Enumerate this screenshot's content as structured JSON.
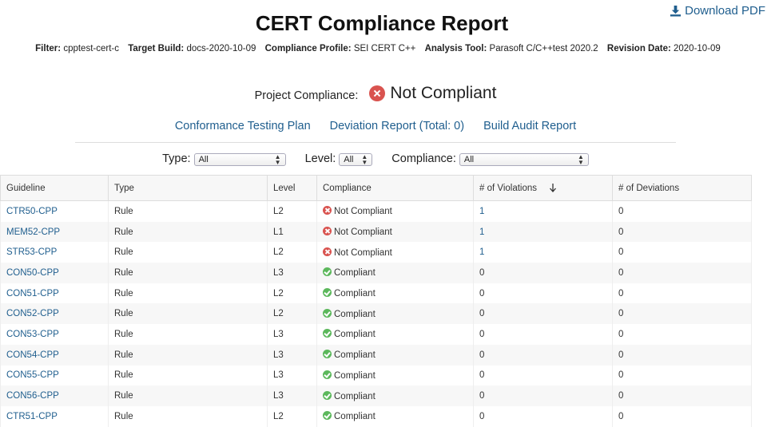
{
  "download_label": "Download PDF",
  "title": "CERT Compliance Report",
  "meta": [
    {
      "label": "Filter:",
      "value": "cpptest-cert-c"
    },
    {
      "label": "Target Build:",
      "value": "docs-2020-10-09"
    },
    {
      "label": "Compliance Profile:",
      "value": "SEI CERT C++"
    },
    {
      "label": "Analysis Tool:",
      "value": "Parasoft C/C++test 2020.2"
    },
    {
      "label": "Revision Date:",
      "value": "2020-10-09"
    }
  ],
  "project": {
    "label": "Project Compliance:",
    "status": "Not Compliant",
    "status_color": "#d9534f"
  },
  "links": {
    "plan": "Conformance Testing Plan",
    "deviation": "Deviation Report (Total: 0)",
    "audit": "Build Audit Report"
  },
  "filters": {
    "type": {
      "label": "Type:",
      "value": "All"
    },
    "level": {
      "label": "Level:",
      "value": "All"
    },
    "compliance": {
      "label": "Compliance:",
      "value": "All"
    }
  },
  "table": {
    "headers": [
      "Guideline",
      "Type",
      "Level",
      "Compliance",
      "# of Violations",
      "# of Deviations"
    ],
    "rows": [
      {
        "guideline": "CTR50-CPP",
        "type": "Rule",
        "level": "L2",
        "compliance": "Not Compliant",
        "violations": "1",
        "deviations": "0"
      },
      {
        "guideline": "MEM52-CPP",
        "type": "Rule",
        "level": "L1",
        "compliance": "Not Compliant",
        "violations": "1",
        "deviations": "0"
      },
      {
        "guideline": "STR53-CPP",
        "type": "Rule",
        "level": "L2",
        "compliance": "Not Compliant",
        "violations": "1",
        "deviations": "0"
      },
      {
        "guideline": "CON50-CPP",
        "type": "Rule",
        "level": "L3",
        "compliance": "Compliant",
        "violations": "0",
        "deviations": "0"
      },
      {
        "guideline": "CON51-CPP",
        "type": "Rule",
        "level": "L2",
        "compliance": "Compliant",
        "violations": "0",
        "deviations": "0"
      },
      {
        "guideline": "CON52-CPP",
        "type": "Rule",
        "level": "L2",
        "compliance": "Compliant",
        "violations": "0",
        "deviations": "0"
      },
      {
        "guideline": "CON53-CPP",
        "type": "Rule",
        "level": "L3",
        "compliance": "Compliant",
        "violations": "0",
        "deviations": "0"
      },
      {
        "guideline": "CON54-CPP",
        "type": "Rule",
        "level": "L3",
        "compliance": "Compliant",
        "violations": "0",
        "deviations": "0"
      },
      {
        "guideline": "CON55-CPP",
        "type": "Rule",
        "level": "L3",
        "compliance": "Compliant",
        "violations": "0",
        "deviations": "0"
      },
      {
        "guideline": "CON56-CPP",
        "type": "Rule",
        "level": "L3",
        "compliance": "Compliant",
        "violations": "0",
        "deviations": "0"
      },
      {
        "guideline": "CTR51-CPP",
        "type": "Rule",
        "level": "L2",
        "compliance": "Compliant",
        "violations": "0",
        "deviations": "0"
      }
    ]
  },
  "colors": {
    "link": "#1f5e8e",
    "fail": "#d9534f",
    "pass": "#5cb85c"
  }
}
